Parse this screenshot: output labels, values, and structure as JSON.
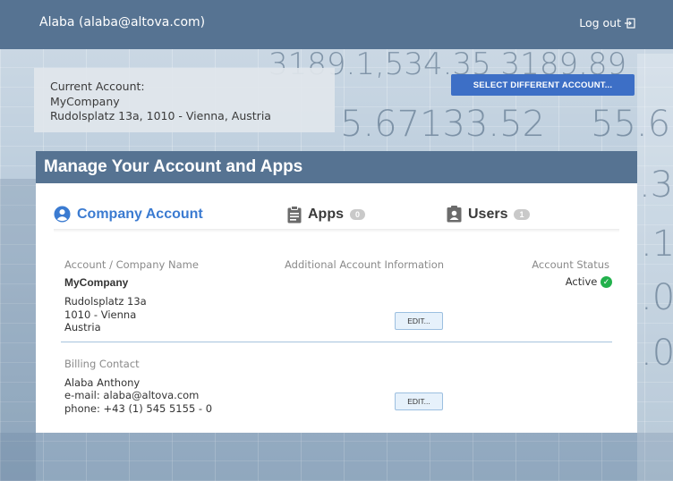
{
  "topbar": {
    "user": "Alaba (alaba@altova.com)",
    "logout_label": "Log out"
  },
  "current_account": {
    "label": "Current Account:",
    "name": "MyCompany",
    "address": "Rudolsplatz 13a, 1010 - Vienna, Austria"
  },
  "select_button": "SELECT DIFFERENT ACCOUNT...",
  "manage": {
    "title": "Manage Your Account and Apps",
    "tabs": [
      {
        "label": "Company Account",
        "icon": "user-circle-icon"
      },
      {
        "label": "Apps",
        "count": "0",
        "icon": "clipboard-icon"
      },
      {
        "label": "Users",
        "count": "1",
        "icon": "user-badge-icon"
      }
    ]
  },
  "account": {
    "col_name": "Account / Company Name",
    "col_info": "Additional Account Information",
    "col_status": "Account Status",
    "company": "MyCompany",
    "address_line1": "Rudolsplatz 13a",
    "address_line2": "1010 - Vienna",
    "address_line3": "Austria",
    "status": "Active",
    "edit_label": "EDIT..."
  },
  "billing": {
    "heading": "Billing Contact",
    "name": "Alaba Anthony",
    "email": "e-mail: alaba@altova.com",
    "phone": "phone: +43 (1) 545 5155 - 0",
    "edit_label": "EDIT..."
  },
  "colors": {
    "header_bg": "#567392",
    "accent": "#3b7bd1",
    "button": "#3d6fc6",
    "ok": "#22b14c"
  }
}
